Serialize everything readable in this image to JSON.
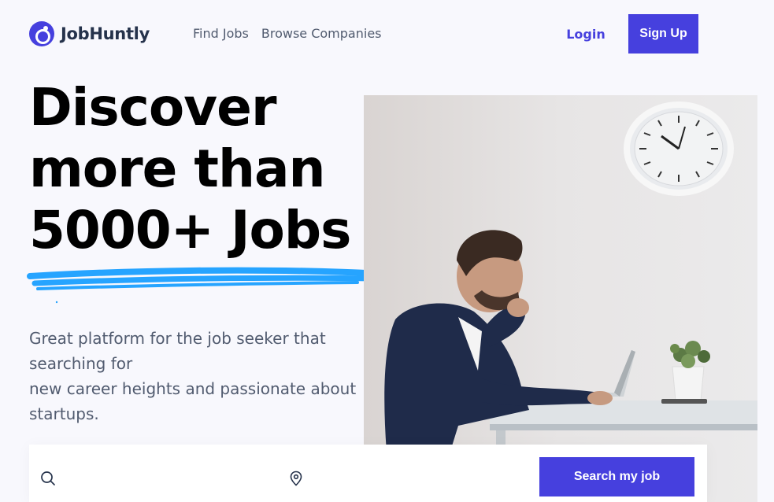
{
  "brand": {
    "name": "JobHuntly",
    "accent_color": "#4640de",
    "highlight_color": "#26a4ff"
  },
  "nav": {
    "items": [
      {
        "label": "Find Jobs"
      },
      {
        "label": "Browse Companies"
      }
    ]
  },
  "auth": {
    "login_label": "Login",
    "signup_label": "Sign Up"
  },
  "hero": {
    "title_lines": [
      "Discover",
      "more than",
      "5000+ Jobs"
    ],
    "description_lines": [
      "Great platform for the job seeker that",
      "searching for",
      "new career heights and passionate about",
      "startups."
    ]
  },
  "search": {
    "keyword_icon": "search-icon",
    "keyword_value": "",
    "location_icon": "map-pin-icon",
    "location_value": "",
    "button_label": "Search my job"
  }
}
